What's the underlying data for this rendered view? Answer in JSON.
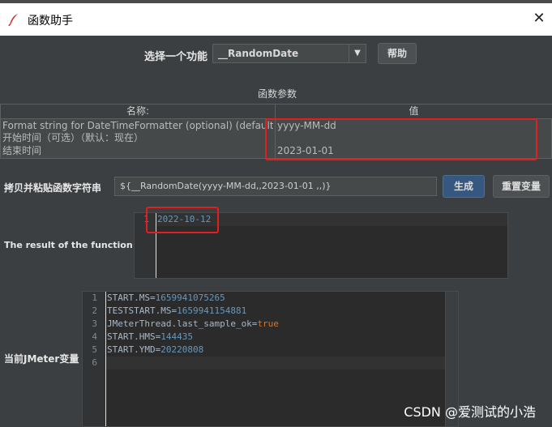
{
  "window": {
    "title": "函数助手",
    "close_glyph": "✕"
  },
  "function_select": {
    "label": "选择一个功能",
    "value": "__RandomDate",
    "arrow": "▼"
  },
  "help_button": "帮助",
  "params": {
    "section_title": "函数参数",
    "columns": [
      "名称:",
      "值"
    ],
    "rows": [
      {
        "name": "Format string for DateTimeFormatter (optional) (default yyyy-...",
        "value": "yyyy-MM-dd"
      },
      {
        "name": "开始时间（可选）（默认：现在）",
        "value": ""
      },
      {
        "name": "结束时间",
        "value": "2023-01-01"
      }
    ]
  },
  "copy": {
    "label": "拷贝并粘贴函数字符串",
    "value": "${__RandomDate(yyyy-MM-dd,,2023-01-01 ,,)}"
  },
  "generate_button": "生成",
  "reset_button": "重置变量",
  "result": {
    "label": "The result of the function is",
    "lines": [
      {
        "num": "1",
        "text": "2022-10-12"
      }
    ]
  },
  "vars": {
    "label": "当前JMeter变量",
    "lines": [
      {
        "num": "1",
        "key": "START.MS=",
        "value": "1659941075265",
        "type": "number"
      },
      {
        "num": "2",
        "key": "TESTSTART.MS=",
        "value": "1659941154881",
        "type": "number"
      },
      {
        "num": "3",
        "key": "JMeterThread.last_sample_ok=",
        "value": "true",
        "type": "keyword"
      },
      {
        "num": "4",
        "key": "START.HMS=",
        "value": "144435",
        "type": "number"
      },
      {
        "num": "5",
        "key": "START.YMD=",
        "value": "20220808",
        "type": "number"
      },
      {
        "num": "6",
        "key": "",
        "value": "",
        "type": "number"
      }
    ]
  },
  "watermark": "CSDN @爱测试的小浩",
  "colors": {
    "highlight_box": "#e02020",
    "number": "#6897bb",
    "keyword": "#cc7832"
  }
}
